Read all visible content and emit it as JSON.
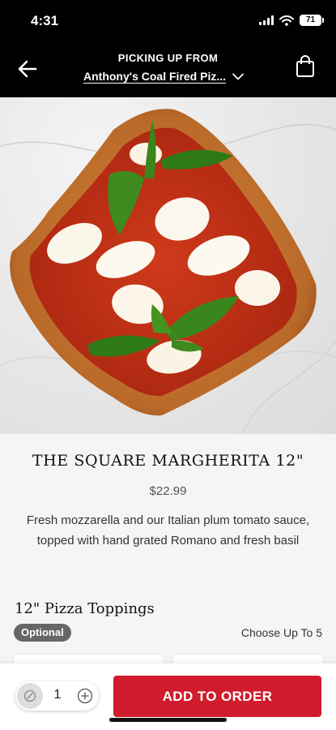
{
  "status_bar": {
    "time": "4:31",
    "battery": "71",
    "icons": [
      "signal-icon",
      "wifi-icon",
      "battery-icon"
    ]
  },
  "header": {
    "pickup_label": "PICKING UP FROM",
    "store_name": "Anthony's Coal Fired Piz...",
    "icons": [
      "back-arrow-icon",
      "chevron-down-icon",
      "shopping-bag-icon"
    ]
  },
  "product": {
    "image": "pizza-photo",
    "title": "THE SQUARE MARGHERITA 12\"",
    "price": "$22.99",
    "description": "Fresh mozzarella and our Italian plum tomato sauce, topped with hand grated Romano and fresh basil"
  },
  "toppings": {
    "title": "12\" Pizza Toppings",
    "badge": "Optional",
    "limit": "Choose Up To 5"
  },
  "footer": {
    "quantity": "1",
    "add_label": "ADD TO ORDER",
    "icons": [
      "minus-icon",
      "plus-icon"
    ]
  },
  "colors": {
    "header_bg": "#000000",
    "accent_red": "#d01c2c",
    "badge_gray": "#666666",
    "info_bg": "#f5f5f5"
  }
}
